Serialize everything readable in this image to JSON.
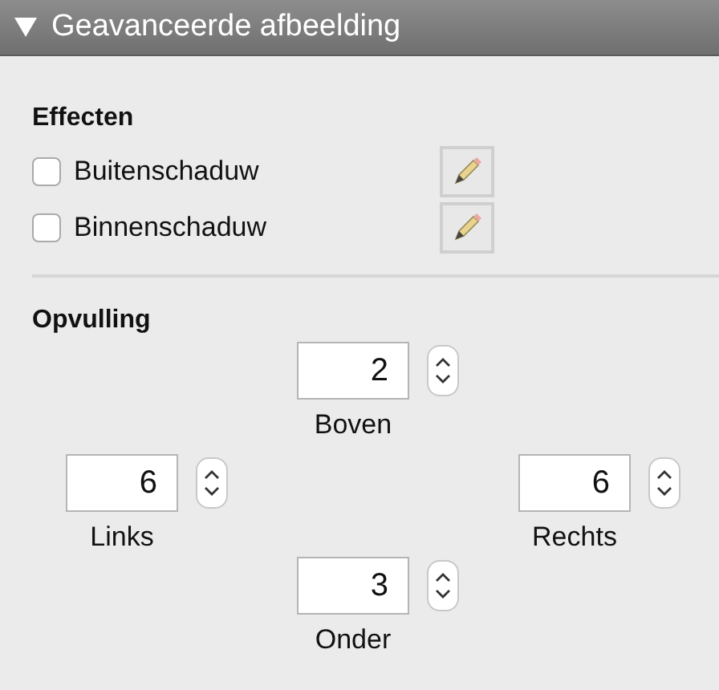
{
  "panel": {
    "title": "Geavanceerde afbeelding",
    "expanded": true
  },
  "effects": {
    "heading": "Effecten",
    "items": [
      {
        "label": "Buitenschaduw",
        "checked": false
      },
      {
        "label": "Binnenschaduw",
        "checked": false
      }
    ]
  },
  "padding": {
    "heading": "Opvulling",
    "fields": [
      {
        "kind": "top",
        "label": "Boven",
        "value": "2"
      },
      {
        "kind": "left",
        "label": "Links",
        "value": "6"
      },
      {
        "kind": "right",
        "label": "Rechts",
        "value": "6"
      },
      {
        "kind": "bottom",
        "label": "Onder",
        "value": "3"
      }
    ]
  }
}
